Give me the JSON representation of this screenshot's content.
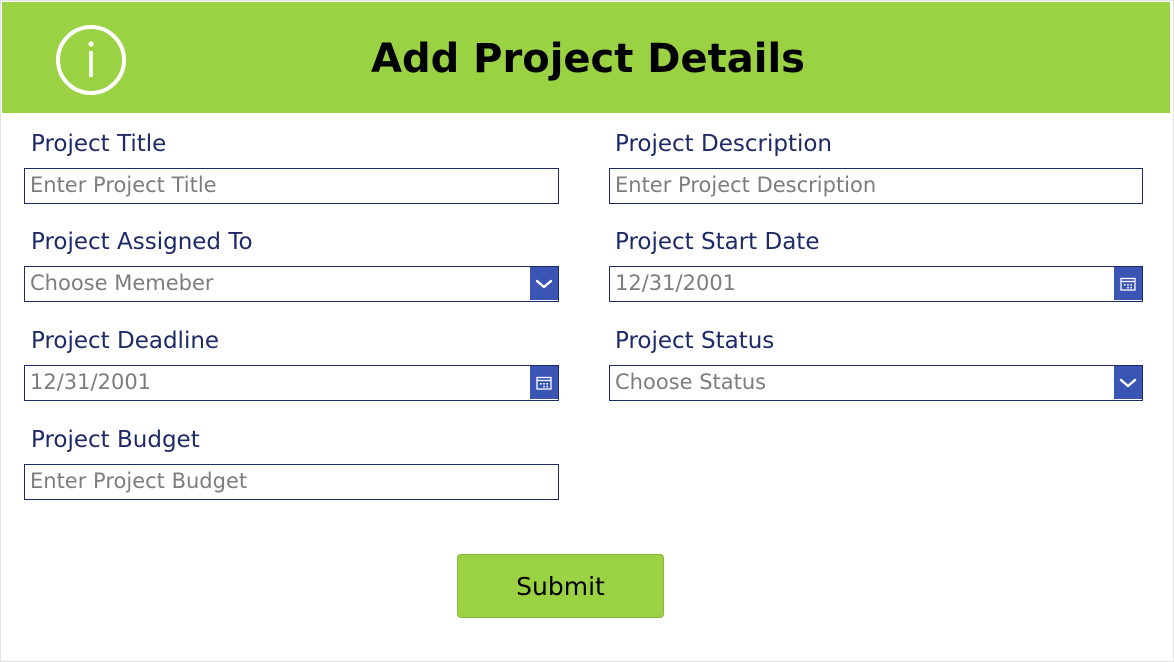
{
  "colors": {
    "accent": "#9bd243",
    "label": "#1d2a66",
    "border": "#1d2a66",
    "button": "#3a55b4"
  },
  "header": {
    "icon": "info-icon",
    "title": "Add Project Details"
  },
  "fields": {
    "project_title": {
      "label": "Project Title",
      "placeholder": "Enter Project Title"
    },
    "project_description": {
      "label": "Project Description",
      "placeholder": "Enter Project Description"
    },
    "project_assigned_to": {
      "label": "Project Assigned To",
      "value": "Choose Memeber",
      "icon": "chevron-down-icon"
    },
    "project_start_date": {
      "label": "Project Start Date",
      "value": "12/31/2001",
      "icon": "calendar-icon"
    },
    "project_deadline": {
      "label": "Project Deadline",
      "value": "12/31/2001",
      "icon": "calendar-icon"
    },
    "project_status": {
      "label": "Project Status",
      "value": "Choose Status",
      "icon": "chevron-down-icon"
    },
    "project_budget": {
      "label": "Project Budget",
      "placeholder": "Enter Project Budget"
    }
  },
  "submit": {
    "label": "Submit"
  }
}
